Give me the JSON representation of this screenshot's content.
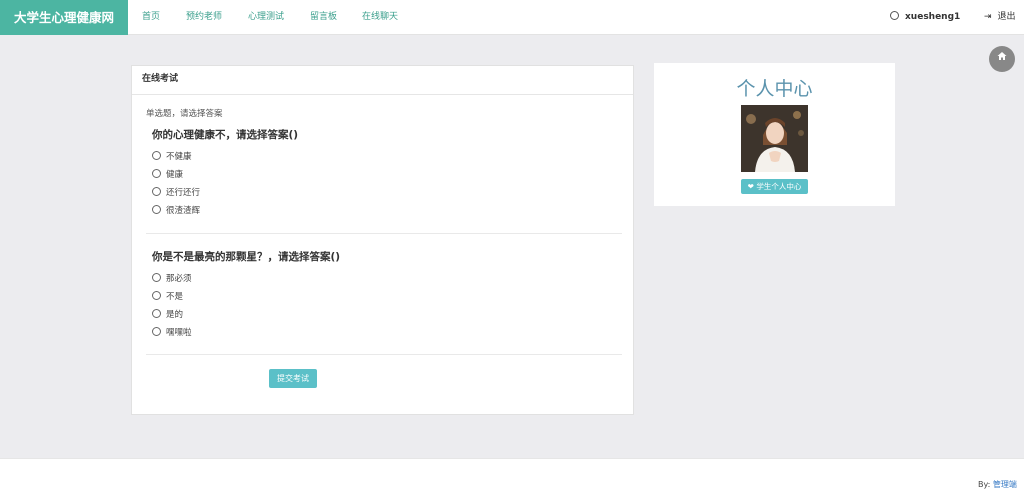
{
  "navbar": {
    "brand": "大学生心理健康网",
    "links": [
      "首页",
      "预约老师",
      "心理测试",
      "留言板",
      "在线聊天"
    ],
    "username": "xuesheng1",
    "logout": "退出"
  },
  "home_icon": "home-icon",
  "exam": {
    "header": "在线考试",
    "hint": "单选题，请选择答案",
    "questions": [
      {
        "title": "你的心理健康不，请选择答案()",
        "options": [
          "不健康",
          "健康",
          "还行还行",
          "很渣渣辉"
        ]
      },
      {
        "title": "你是不是最亮的那颗星？，请选择答案()",
        "options": [
          "那必须",
          "不是",
          "是的",
          "嘿嘿啦"
        ]
      }
    ],
    "submit": "提交考试"
  },
  "profile": {
    "title": "个人中心",
    "button": "学生个人中心",
    "button_icon": "heart-icon"
  },
  "footer": {
    "by_label": "By:",
    "link": "管理端"
  },
  "colors": {
    "brand": "#4cb5a2",
    "accent": "#5bc0c8",
    "nav_link": "#3a9f8c",
    "profile_title": "#5b93ad"
  }
}
